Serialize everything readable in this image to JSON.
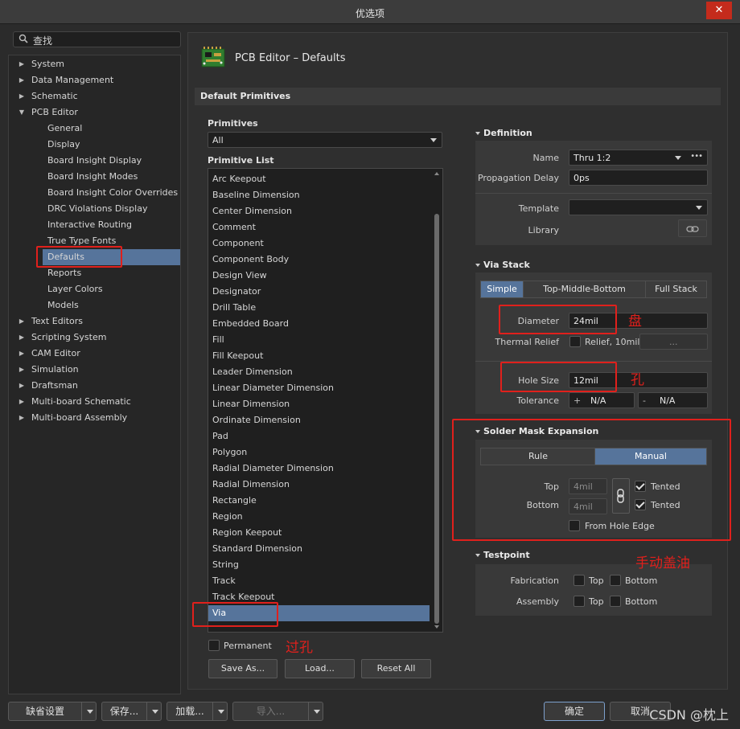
{
  "window": {
    "title": "优选项",
    "close_glyph": "✕"
  },
  "search": {
    "placeholder": "查找"
  },
  "tree": [
    {
      "label": "System",
      "expander": "right"
    },
    {
      "label": "Data Management",
      "expander": "right"
    },
    {
      "label": "Schematic",
      "expander": "right"
    },
    {
      "label": "PCB Editor",
      "expander": "down"
    },
    {
      "label": "General",
      "child": true
    },
    {
      "label": "Display",
      "child": true
    },
    {
      "label": "Board Insight Display",
      "child": true
    },
    {
      "label": "Board Insight Modes",
      "child": true
    },
    {
      "label": "Board Insight Color Overrides",
      "child": true
    },
    {
      "label": "DRC Violations Display",
      "child": true
    },
    {
      "label": "Interactive Routing",
      "child": true
    },
    {
      "label": "True Type Fonts",
      "child": true
    },
    {
      "label": "Defaults",
      "child": true,
      "selected": true
    },
    {
      "label": "Reports",
      "child": true
    },
    {
      "label": "Layer Colors",
      "child": true
    },
    {
      "label": "Models",
      "child": true
    },
    {
      "label": "Text Editors",
      "expander": "right"
    },
    {
      "label": "Scripting System",
      "expander": "right"
    },
    {
      "label": "CAM Editor",
      "expander": "right"
    },
    {
      "label": "Simulation",
      "expander": "right"
    },
    {
      "label": "Draftsman",
      "expander": "right"
    },
    {
      "label": "Multi-board Schematic",
      "expander": "right"
    },
    {
      "label": "Multi-board Assembly",
      "expander": "right"
    }
  ],
  "page": {
    "title": "PCB Editor – Defaults",
    "icon": "pcb-board-icon"
  },
  "section": {
    "title": "Default Primitives"
  },
  "primitives": {
    "label": "Primitives",
    "value": "All"
  },
  "primitive_list": {
    "label": "Primitive List",
    "items": [
      "Arc Keepout",
      "Baseline Dimension",
      "Center Dimension",
      "Comment",
      "Component",
      "Component Body",
      "Design View",
      "Designator",
      "Drill Table",
      "Embedded Board",
      "Fill",
      "Fill Keepout",
      "Leader Dimension",
      "Linear Diameter Dimension",
      "Linear Dimension",
      "Ordinate Dimension",
      "Pad",
      "Polygon",
      "Radial Diameter Dimension",
      "Radial Dimension",
      "Rectangle",
      "Region",
      "Region Keepout",
      "Standard Dimension",
      "String",
      "Track",
      "Track Keepout",
      "Via"
    ],
    "selected": "Via"
  },
  "permanent": {
    "label": "Permanent",
    "checked": false
  },
  "buttons": {
    "save_as": "Save As...",
    "load": "Load...",
    "reset_all": "Reset All"
  },
  "definition": {
    "title": "Definition",
    "name_label": "Name",
    "name_value": "Thru 1:2",
    "more": "•••",
    "prop_label": "Propagation Delay",
    "prop_value": "0ps",
    "template_label": "Template",
    "template_value": "",
    "library_label": "Library",
    "library_icon": "link-icon"
  },
  "via_stack": {
    "title": "Via Stack",
    "tabs": [
      "Simple",
      "Top-Middle-Bottom",
      "Full Stack"
    ],
    "active_tab": "Simple",
    "diameter_label": "Diameter",
    "diameter_value": "24mil",
    "thermal_label": "Thermal Relief",
    "thermal_value": "Relief, 10mil,",
    "thermal_more": "...",
    "hole_label": "Hole Size",
    "hole_value": "12mil",
    "tolerance_label": "Tolerance",
    "tol_plus": "+",
    "tol_plus_value": "N/A",
    "tol_minus": "-",
    "tol_minus_value": "N/A"
  },
  "solder_mask": {
    "title": "Solder Mask Expansion",
    "tabs": [
      "Rule",
      "Manual"
    ],
    "active_tab": "Manual",
    "top_label": "Top",
    "top_value": "4mil",
    "top_tented": "Tented",
    "top_tented_checked": true,
    "bottom_label": "Bottom",
    "bottom_value": "4mil",
    "bottom_tented": "Tented",
    "bottom_tented_checked": true,
    "from_hole_edge": "From Hole Edge",
    "from_hole_edge_checked": false
  },
  "testpoint": {
    "title": "Testpoint",
    "fabrication_label": "Fabrication",
    "assembly_label": "Assembly",
    "top": "Top",
    "bottom": "Bottom"
  },
  "annotations": {
    "pad": "盘",
    "hole": "孔",
    "via": "过孔",
    "manual_mask": "手动盖油",
    "accent": "#e0201c"
  },
  "footer": {
    "defaults": "缺省设置",
    "save": "保存...",
    "load": "加载...",
    "import": "导入...",
    "ok": "确定",
    "cancel": "取消"
  },
  "watermark": "CSDN @枕上",
  "colors": {
    "selection": "#56749b",
    "background": "#2b2b2b"
  }
}
